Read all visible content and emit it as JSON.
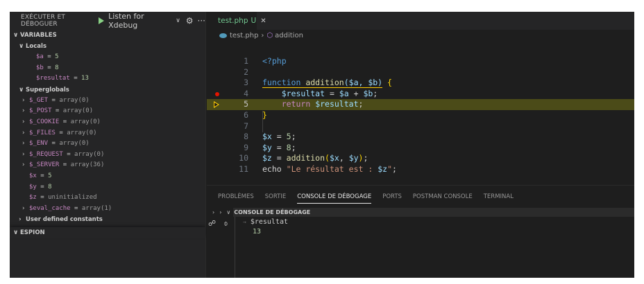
{
  "run": {
    "title": "EXÉCUTER ET DÉBOGUER",
    "config": "Listen for Xdebug",
    "dropdown_icon": "chevron-down-icon",
    "gear_icon": "gear-icon",
    "more_icon": "ellipsis-icon"
  },
  "variables": {
    "section_title": "VARIABLES",
    "locals_title": "Locals",
    "locals": [
      {
        "name": "$a",
        "value": "5"
      },
      {
        "name": "$b",
        "value": "8"
      },
      {
        "name": "$resultat",
        "value": "13"
      }
    ],
    "superglobals_title": "Superglobals",
    "superglobals": [
      {
        "name": "$_GET",
        "value": "array(0)",
        "expandable": true
      },
      {
        "name": "$_POST",
        "value": "array(0)",
        "expandable": true
      },
      {
        "name": "$_COOKIE",
        "value": "array(0)",
        "expandable": true
      },
      {
        "name": "$_FILES",
        "value": "array(0)",
        "expandable": true
      },
      {
        "name": "$_ENV",
        "value": "array(0)",
        "expandable": true
      },
      {
        "name": "$_REQUEST",
        "value": "array(0)",
        "expandable": true
      },
      {
        "name": "$_SERVER",
        "value": "array(36)",
        "expandable": true
      },
      {
        "name": "$x",
        "value": "5",
        "expandable": false
      },
      {
        "name": "$y",
        "value": "8",
        "expandable": false
      },
      {
        "name": "$z",
        "value": "uninitialized",
        "expandable": false
      },
      {
        "name": "$eval_cache",
        "value": "array(1)",
        "expandable": true
      }
    ],
    "user_constants_title": "User defined constants"
  },
  "watch": {
    "section_title": "ESPION"
  },
  "editor": {
    "tab_label": "test.php",
    "tab_status": "U",
    "breadcrumb_file": "test.php",
    "breadcrumb_symbol": "addition",
    "lines": [
      {
        "n": "1",
        "t1": "<?php"
      },
      {
        "n": "2"
      },
      {
        "n": "3",
        "kw": "function",
        "fn": "addition",
        "args": "($a, $b)",
        "brace": "{"
      },
      {
        "n": "4",
        "v1": "$resultat",
        "eq": " = ",
        "v2": "$a",
        "plus": " + ",
        "v3": "$b",
        "semi": ";"
      },
      {
        "n": "5",
        "ret": "return",
        "rv": "$resultat",
        "semi": ";"
      },
      {
        "n": "6",
        "brace": "}"
      },
      {
        "n": "7"
      },
      {
        "n": "8",
        "v": "$x",
        "eq": " = ",
        "num": "5",
        "semi": ";"
      },
      {
        "n": "9",
        "v": "$y",
        "eq": " = ",
        "num": "8",
        "semi": ";"
      },
      {
        "n": "10",
        "v": "$z",
        "eq": " = ",
        "fn": "addition",
        "a1": "$x",
        "a2": "$y",
        "semi": ";"
      },
      {
        "n": "11",
        "echo": "echo",
        "str": "\"Le résultat est : ",
        "sv": "$z",
        "strend": "\"",
        "semi": ";"
      }
    ]
  },
  "panel": {
    "tabs": [
      "PROBLÈMES",
      "SORTIE",
      "CONSOLE DE DÉBOGAGE",
      "PORTS",
      "POSTMAN CONSOLE",
      "TERMINAL"
    ],
    "active_tab": "CONSOLE DE DÉBOGAGE",
    "console_title": "CONSOLE DE DÉBOGAGE",
    "output_expr": "$resultat",
    "output_value": "13"
  },
  "colors": {
    "background": "#1e1e1e",
    "sidebar": "#252526",
    "current_line": "#4b4b18",
    "breakpoint": "#e51400",
    "stop_arrow": "#ffcc00"
  }
}
